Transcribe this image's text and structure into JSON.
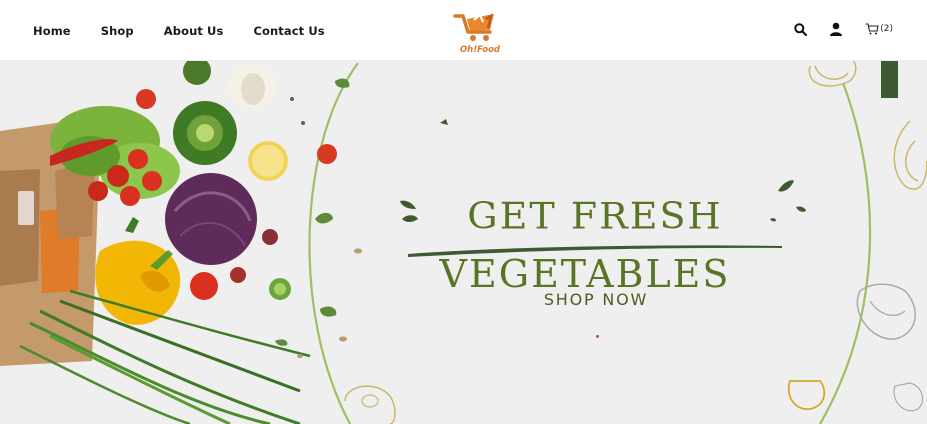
{
  "nav": {
    "items": [
      {
        "label": "Home"
      },
      {
        "label": "Shop"
      },
      {
        "label": "About Us"
      },
      {
        "label": "Contact Us"
      }
    ]
  },
  "logo": {
    "text": "Oh!Food",
    "icon": "shopping-cart-logo-icon",
    "color": "#d8792a"
  },
  "header_icons": {
    "search": "search-icon",
    "account": "user-icon",
    "cart": "cart-icon",
    "cart_count": "(2)"
  },
  "hero": {
    "headline_line1": "GET FRESH",
    "headline_line2": "VEGETABLES",
    "cta_label": "SHOP NOW",
    "headline_color": "#5a7425",
    "background": "#efefef"
  }
}
